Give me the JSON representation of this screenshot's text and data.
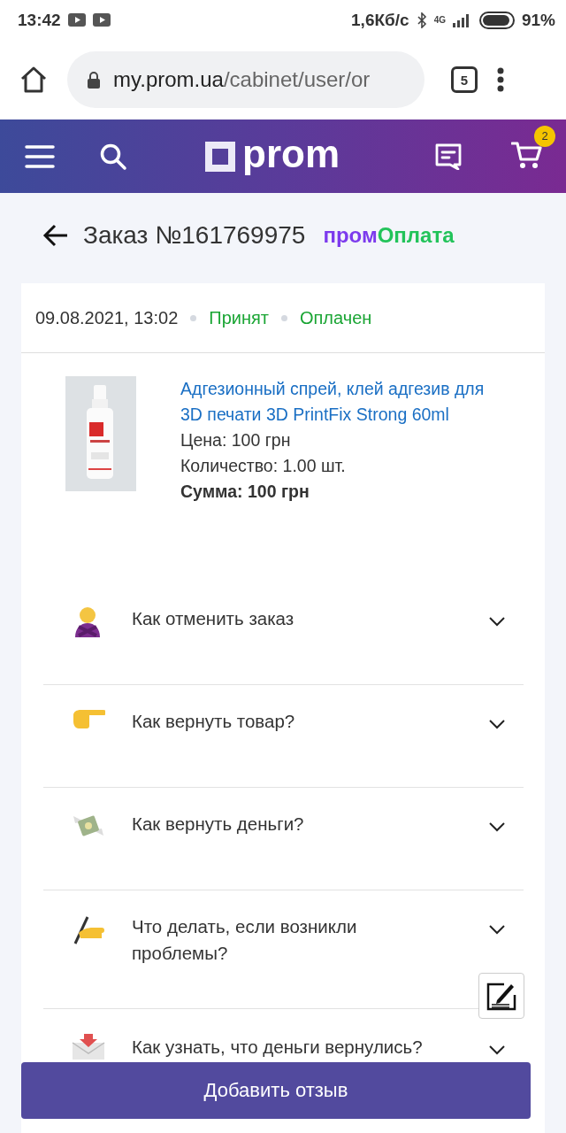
{
  "status_bar": {
    "time": "13:42",
    "speed": "1,6Кб/с",
    "network": "4G",
    "battery": "91%"
  },
  "browser": {
    "url_host": "my.prom.ua",
    "url_path": "/cabinet/user/or",
    "tab_count": "5"
  },
  "site_header": {
    "logo": "prom",
    "cart_count": "2"
  },
  "order": {
    "title": "Заказ №161769975",
    "payment_prefix": "пром",
    "payment_suffix": "Оплата"
  },
  "card": {
    "date": "09.08.2021, 13:02",
    "statuses": [
      {
        "label": "Принят",
        "color": "#1aa534"
      },
      {
        "label": "Оплачен",
        "color": "#1aa534"
      }
    ],
    "product": {
      "name": "Адгезионный спрей, клей адгезив для 3D печати 3D PrintFix Strong 60ml",
      "price": "Цена: 100 грн",
      "quantity": "Количество: 1.00 шт.",
      "total": "Сумма: 100 грн"
    }
  },
  "faq": [
    {
      "kind": "cross",
      "question": "Как отменить заказ",
      "expanded": false
    },
    {
      "kind": "point",
      "question": "Как вернуть товар?",
      "expanded": false
    },
    {
      "kind": "money",
      "question": "Как вернуть деньги?",
      "expanded": false
    },
    {
      "kind": "write",
      "question": "Что делать, если возникли проблемы?",
      "expanded": false
    },
    {
      "kind": "mail",
      "question": "Как узнать, что деньги вернулись?",
      "expanded": false
    }
  ],
  "review_button": "Добавить отзыв"
}
